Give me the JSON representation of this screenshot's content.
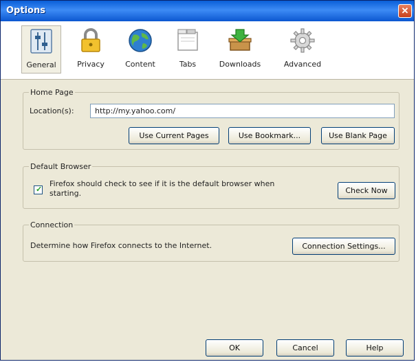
{
  "window": {
    "title": "Options",
    "close_label": "✕"
  },
  "toolbar": {
    "items": [
      {
        "label": "General"
      },
      {
        "label": "Privacy"
      },
      {
        "label": "Content"
      },
      {
        "label": "Tabs"
      },
      {
        "label": "Downloads"
      },
      {
        "label": "Advanced"
      }
    ],
    "selected": "General"
  },
  "home_page": {
    "group_title": "Home Page",
    "location_label": "Location(s):",
    "location_value": "http://my.yahoo.com/",
    "buttons": {
      "use_current": "Use Current Pages",
      "use_bookmark": "Use Bookmark...",
      "use_blank": "Use Blank Page"
    }
  },
  "default_browser": {
    "group_title": "Default Browser",
    "check_text_line1": "Firefox should check to see if it is the default browser when",
    "check_text_line2": "starting.",
    "checked": true,
    "check_now": "Check Now"
  },
  "connection": {
    "group_title": "Connection",
    "description": "Determine how Firefox connects to the Internet.",
    "settings_button": "Connection Settings..."
  },
  "footer": {
    "ok": "OK",
    "cancel": "Cancel",
    "help": "Help"
  }
}
